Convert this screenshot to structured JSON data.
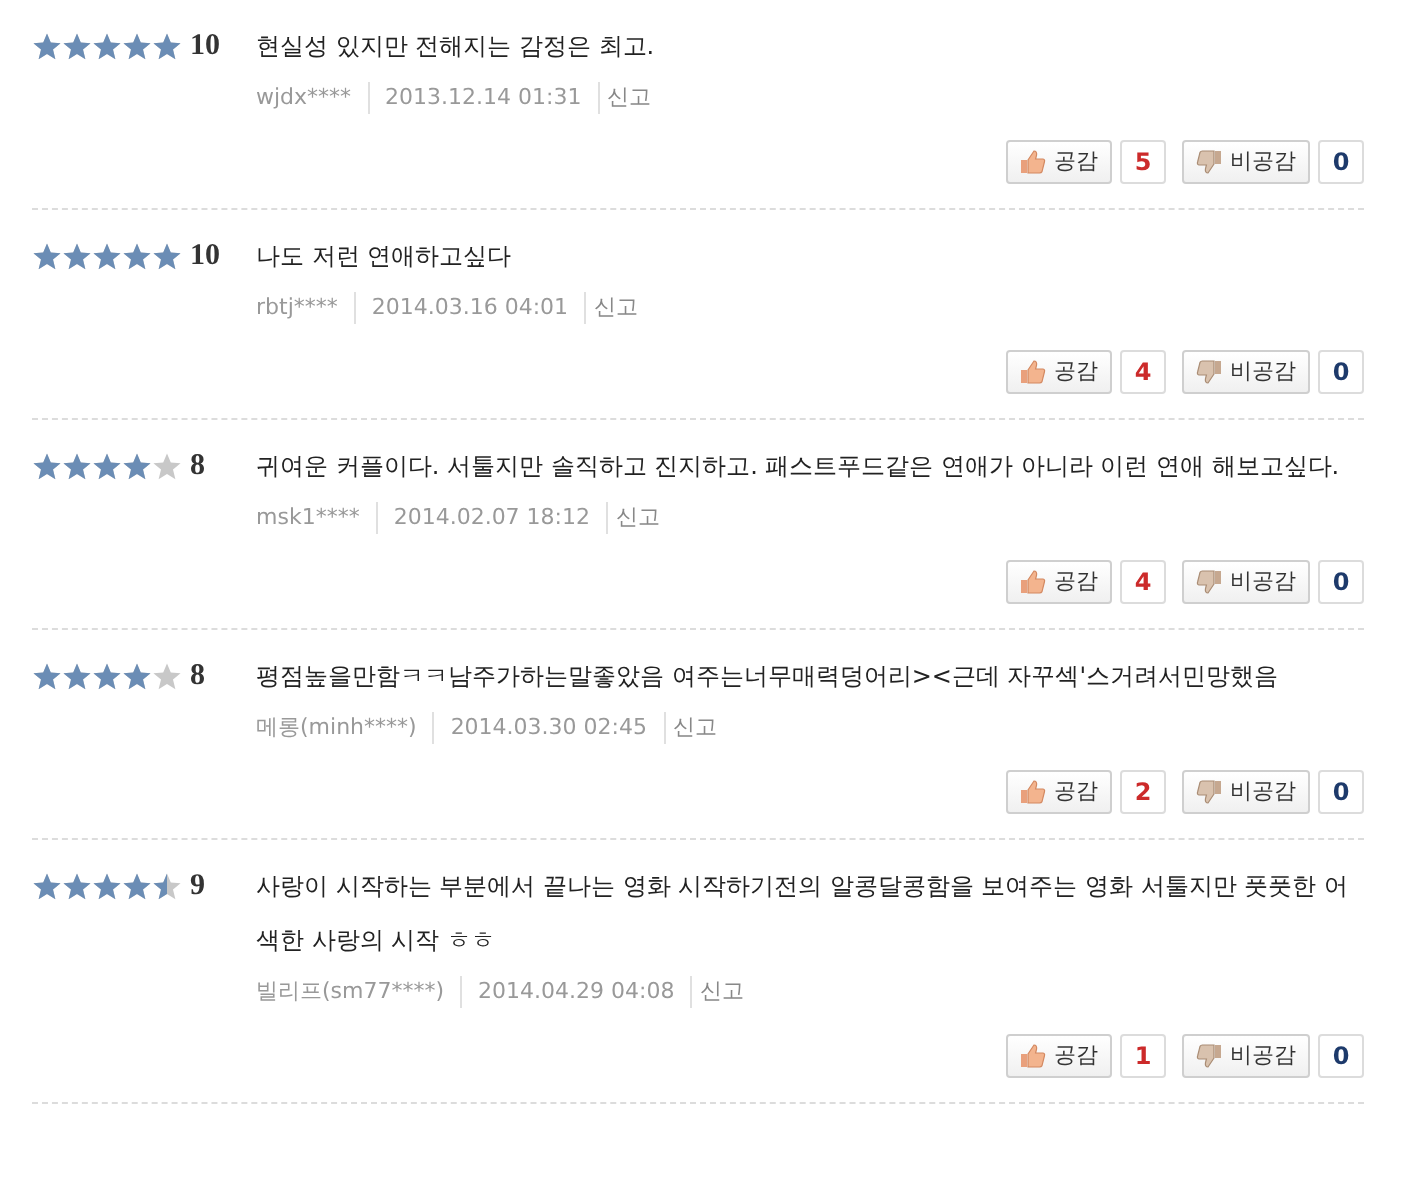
{
  "reviews": [
    {
      "stars": 5,
      "score": "10",
      "text": "현실성 있지만 전해지는 감정은 최고.",
      "author": "wjdx****",
      "date": "2013.12.14 01:31",
      "report": "신고",
      "like_label": "공감",
      "likes": "5",
      "dislike_label": "비공감",
      "dislikes": "0"
    },
    {
      "stars": 5,
      "score": "10",
      "text": "나도 저런 연애하고싶다",
      "author": "rbtj****",
      "date": "2014.03.16 04:01",
      "report": "신고",
      "like_label": "공감",
      "likes": "4",
      "dislike_label": "비공감",
      "dislikes": "0"
    },
    {
      "stars": 4,
      "score": "8",
      "text": "귀여운 커플이다. 서툴지만 솔직하고 진지하고. 패스트푸드같은 연애가 아니라 이런 연애 해보고싶다.",
      "author": "msk1****",
      "date": "2014.02.07 18:12",
      "report": "신고",
      "like_label": "공감",
      "likes": "4",
      "dislike_label": "비공감",
      "dislikes": "0"
    },
    {
      "stars": 4,
      "score": "8",
      "text": "평점높을만함ㅋㅋ남주가하는말좋았음 여주는너무매력덩어리><근데 자꾸섹'스거려서민망했음",
      "author": "메롱(minh****)",
      "date": "2014.03.30 02:45",
      "report": "신고",
      "like_label": "공감",
      "likes": "2",
      "dislike_label": "비공감",
      "dislikes": "0"
    },
    {
      "stars": 4.5,
      "score": "9",
      "text": "사랑이 시작하는 부분에서 끝나는 영화 시작하기전의 알콩달콩함을 보여주는 영화 서툴지만 풋풋한 어색한 사랑의 시작 ㅎㅎ",
      "author": "빌리프(sm77****)",
      "date": "2014.04.29 04:08",
      "report": "신고",
      "like_label": "공감",
      "likes": "1",
      "dislike_label": "비공감",
      "dislikes": "0"
    }
  ]
}
